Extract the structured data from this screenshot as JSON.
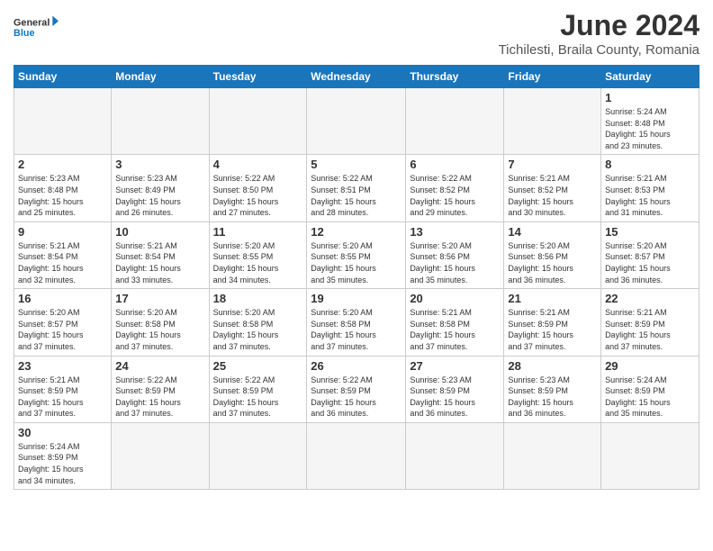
{
  "header": {
    "logo_general": "General",
    "logo_blue": "Blue",
    "month_title": "June 2024",
    "location": "Tichilesti, Braila County, Romania"
  },
  "weekdays": [
    "Sunday",
    "Monday",
    "Tuesday",
    "Wednesday",
    "Thursday",
    "Friday",
    "Saturday"
  ],
  "weeks": [
    {
      "days": [
        {
          "num": "",
          "info": ""
        },
        {
          "num": "",
          "info": ""
        },
        {
          "num": "",
          "info": ""
        },
        {
          "num": "",
          "info": ""
        },
        {
          "num": "",
          "info": ""
        },
        {
          "num": "",
          "info": ""
        },
        {
          "num": "1",
          "info": "Sunrise: 5:24 AM\nSunset: 8:48 PM\nDaylight: 15 hours\nand 23 minutes."
        }
      ]
    },
    {
      "days": [
        {
          "num": "2",
          "info": "Sunrise: 5:23 AM\nSunset: 8:48 PM\nDaylight: 15 hours\nand 25 minutes."
        },
        {
          "num": "3",
          "info": "Sunrise: 5:23 AM\nSunset: 8:49 PM\nDaylight: 15 hours\nand 26 minutes."
        },
        {
          "num": "4",
          "info": "Sunrise: 5:22 AM\nSunset: 8:50 PM\nDaylight: 15 hours\nand 27 minutes."
        },
        {
          "num": "5",
          "info": "Sunrise: 5:22 AM\nSunset: 8:51 PM\nDaylight: 15 hours\nand 28 minutes."
        },
        {
          "num": "6",
          "info": "Sunrise: 5:22 AM\nSunset: 8:52 PM\nDaylight: 15 hours\nand 29 minutes."
        },
        {
          "num": "7",
          "info": "Sunrise: 5:21 AM\nSunset: 8:52 PM\nDaylight: 15 hours\nand 30 minutes."
        },
        {
          "num": "8",
          "info": "Sunrise: 5:21 AM\nSunset: 8:53 PM\nDaylight: 15 hours\nand 31 minutes."
        }
      ]
    },
    {
      "days": [
        {
          "num": "9",
          "info": "Sunrise: 5:21 AM\nSunset: 8:54 PM\nDaylight: 15 hours\nand 32 minutes."
        },
        {
          "num": "10",
          "info": "Sunrise: 5:21 AM\nSunset: 8:54 PM\nDaylight: 15 hours\nand 33 minutes."
        },
        {
          "num": "11",
          "info": "Sunrise: 5:20 AM\nSunset: 8:55 PM\nDaylight: 15 hours\nand 34 minutes."
        },
        {
          "num": "12",
          "info": "Sunrise: 5:20 AM\nSunset: 8:55 PM\nDaylight: 15 hours\nand 35 minutes."
        },
        {
          "num": "13",
          "info": "Sunrise: 5:20 AM\nSunset: 8:56 PM\nDaylight: 15 hours\nand 35 minutes."
        },
        {
          "num": "14",
          "info": "Sunrise: 5:20 AM\nSunset: 8:56 PM\nDaylight: 15 hours\nand 36 minutes."
        },
        {
          "num": "15",
          "info": "Sunrise: 5:20 AM\nSunset: 8:57 PM\nDaylight: 15 hours\nand 36 minutes."
        }
      ]
    },
    {
      "days": [
        {
          "num": "16",
          "info": "Sunrise: 5:20 AM\nSunset: 8:57 PM\nDaylight: 15 hours\nand 37 minutes."
        },
        {
          "num": "17",
          "info": "Sunrise: 5:20 AM\nSunset: 8:58 PM\nDaylight: 15 hours\nand 37 minutes."
        },
        {
          "num": "18",
          "info": "Sunrise: 5:20 AM\nSunset: 8:58 PM\nDaylight: 15 hours\nand 37 minutes."
        },
        {
          "num": "19",
          "info": "Sunrise: 5:20 AM\nSunset: 8:58 PM\nDaylight: 15 hours\nand 37 minutes."
        },
        {
          "num": "20",
          "info": "Sunrise: 5:21 AM\nSunset: 8:58 PM\nDaylight: 15 hours\nand 37 minutes."
        },
        {
          "num": "21",
          "info": "Sunrise: 5:21 AM\nSunset: 8:59 PM\nDaylight: 15 hours\nand 37 minutes."
        },
        {
          "num": "22",
          "info": "Sunrise: 5:21 AM\nSunset: 8:59 PM\nDaylight: 15 hours\nand 37 minutes."
        }
      ]
    },
    {
      "days": [
        {
          "num": "23",
          "info": "Sunrise: 5:21 AM\nSunset: 8:59 PM\nDaylight: 15 hours\nand 37 minutes."
        },
        {
          "num": "24",
          "info": "Sunrise: 5:22 AM\nSunset: 8:59 PM\nDaylight: 15 hours\nand 37 minutes."
        },
        {
          "num": "25",
          "info": "Sunrise: 5:22 AM\nSunset: 8:59 PM\nDaylight: 15 hours\nand 37 minutes."
        },
        {
          "num": "26",
          "info": "Sunrise: 5:22 AM\nSunset: 8:59 PM\nDaylight: 15 hours\nand 36 minutes."
        },
        {
          "num": "27",
          "info": "Sunrise: 5:23 AM\nSunset: 8:59 PM\nDaylight: 15 hours\nand 36 minutes."
        },
        {
          "num": "28",
          "info": "Sunrise: 5:23 AM\nSunset: 8:59 PM\nDaylight: 15 hours\nand 36 minutes."
        },
        {
          "num": "29",
          "info": "Sunrise: 5:24 AM\nSunset: 8:59 PM\nDaylight: 15 hours\nand 35 minutes."
        }
      ]
    },
    {
      "days": [
        {
          "num": "30",
          "info": "Sunrise: 5:24 AM\nSunset: 8:59 PM\nDaylight: 15 hours\nand 34 minutes."
        },
        {
          "num": "",
          "info": ""
        },
        {
          "num": "",
          "info": ""
        },
        {
          "num": "",
          "info": ""
        },
        {
          "num": "",
          "info": ""
        },
        {
          "num": "",
          "info": ""
        },
        {
          "num": "",
          "info": ""
        }
      ]
    }
  ]
}
